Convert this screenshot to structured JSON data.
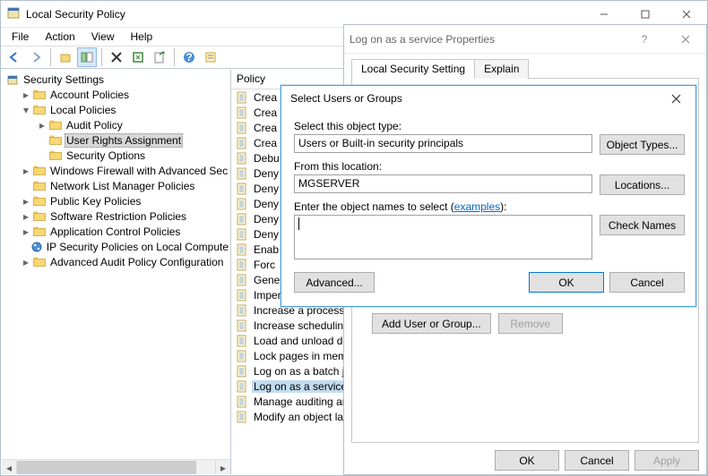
{
  "window": {
    "title": "Local Security Policy",
    "menu": {
      "items": [
        "File",
        "Action",
        "View",
        "Help"
      ]
    },
    "toolbar_icons": [
      "back",
      "forward",
      "up",
      "show-hide-tree",
      "delete",
      "refresh",
      "export",
      "properties",
      "help",
      "console-tree"
    ]
  },
  "tree": {
    "root": "Security Settings",
    "nodes": [
      {
        "label": "Account Policies",
        "indent": 1,
        "toggle": "▷"
      },
      {
        "label": "Local Policies",
        "indent": 1,
        "toggle": "▽",
        "open": true
      },
      {
        "label": "Audit Policy",
        "indent": 2,
        "toggle": "▷"
      },
      {
        "label": "User Rights Assignment",
        "indent": 2,
        "selected": true
      },
      {
        "label": "Security Options",
        "indent": 2
      },
      {
        "label": "Windows Firewall with Advanced Sec",
        "indent": 1,
        "toggle": "▷"
      },
      {
        "label": "Network List Manager Policies",
        "indent": 1
      },
      {
        "label": "Public Key Policies",
        "indent": 1,
        "toggle": "▷"
      },
      {
        "label": "Software Restriction Policies",
        "indent": 1,
        "toggle": "▷"
      },
      {
        "label": "Application Control Policies",
        "indent": 1,
        "toggle": "▷"
      },
      {
        "label": "IP Security Policies on Local Compute",
        "indent": 1,
        "icon": "ipsec"
      },
      {
        "label": "Advanced Audit Policy Configuration",
        "indent": 1,
        "toggle": "▷"
      }
    ]
  },
  "list": {
    "header": "Policy",
    "items": [
      "Crea",
      "Crea",
      "Crea",
      "Crea",
      "Debu",
      "Deny",
      "Deny",
      "Deny",
      "Deny",
      "Deny",
      "Enab",
      "Forc",
      "Gene",
      "Impersonate a client",
      "Increase a process w",
      "Increase scheduling",
      "Load and unload dev",
      "Lock pages in memo",
      "Log on as a batch jo",
      "Log on as a service",
      "Manage auditing an",
      "Modify an object lab"
    ],
    "selected_index": 19
  },
  "props": {
    "title": "Log on as a service Properties",
    "tabs": [
      "Local Security Setting",
      "Explain"
    ],
    "active_tab": 0,
    "buttons": {
      "add": "Add User or Group...",
      "remove": "Remove",
      "ok": "OK",
      "cancel": "Cancel",
      "apply": "Apply"
    }
  },
  "select_dialog": {
    "title": "Select Users or Groups",
    "object_type_label": "Select this object type:",
    "object_type_value": "Users or Built-in security principals",
    "object_types_btn": "Object Types...",
    "location_label": "From this location:",
    "location_value": "MGSERVER",
    "locations_btn": "Locations...",
    "names_label_pre": "Enter the object names to select (",
    "examples_link": "examples",
    "names_label_post": "):",
    "names_value": "",
    "check_names_btn": "Check Names",
    "advanced_btn": "Advanced...",
    "ok": "OK",
    "cancel": "Cancel"
  }
}
